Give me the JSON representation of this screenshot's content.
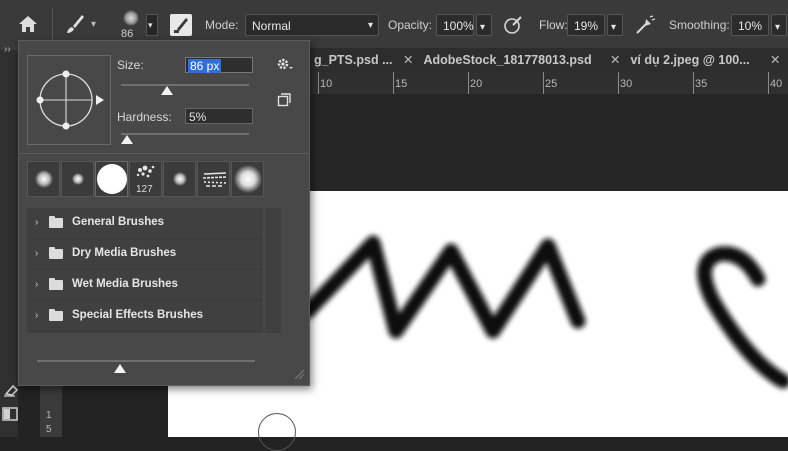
{
  "toolbar": {
    "brush_size_value": "86",
    "mode_label": "Mode:",
    "mode_value": "Normal",
    "opacity_label": "Opacity:",
    "opacity_value": "100%",
    "flow_label": "Flow:",
    "flow_value": "19%",
    "smoothing_label": "Smoothing:",
    "smoothing_value": "10%"
  },
  "tabs": [
    {
      "label": "g_PTS.psd ..."
    },
    {
      "label": "AdobeStock_181778013.psd"
    },
    {
      "label": "ví dụ 2.jpeg @ 100..."
    }
  ],
  "ruler": {
    "ticks": [
      "10",
      "15",
      "20",
      "25",
      "30",
      "35",
      "40"
    ]
  },
  "brush_panel": {
    "size_label": "Size:",
    "size_value": "86 px",
    "hardness_label": "Hardness:",
    "hardness_value": "5%",
    "size_slider": 0.25,
    "hardness_slider": 0.05,
    "preset_count_label": "127",
    "folders": [
      {
        "label": "General Brushes"
      },
      {
        "label": "Dry Media Brushes"
      },
      {
        "label": "Wet Media Brushes"
      },
      {
        "label": "Special Effects Brushes"
      }
    ]
  },
  "left_ruler": {
    "tick": "1",
    "tick2": "5"
  },
  "colors": {
    "accent": "#2f6fd6"
  }
}
